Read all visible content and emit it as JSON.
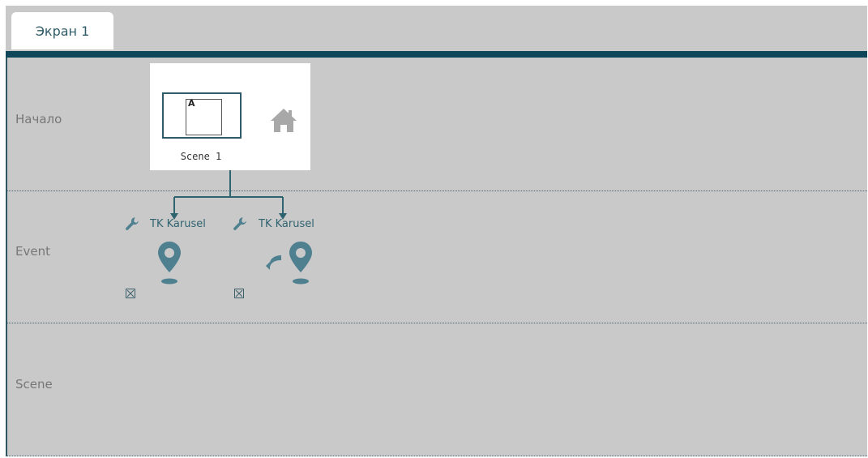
{
  "tabs": [
    {
      "label": "Экран 1",
      "active": true
    }
  ],
  "rows": [
    {
      "label": "Начало"
    },
    {
      "label": "Event"
    },
    {
      "label": "Scene"
    }
  ],
  "scene_card": {
    "name": "Scene 1",
    "thumbnail_letter": "A",
    "icon": "home-icon"
  },
  "events": [
    {
      "label": "TK Karusel",
      "icon": "wrench-icon",
      "marker": "map-pin-icon",
      "checkbox": "checkbox-x-icon"
    },
    {
      "label": "TK Karusel",
      "icon": "wrench-icon",
      "marker": "map-pin-return-icon",
      "checkbox": "checkbox-x-icon"
    }
  ],
  "colors": {
    "accent": "#0e4759",
    "icon": "#4f8090",
    "canvas": "#c9c9c9"
  }
}
